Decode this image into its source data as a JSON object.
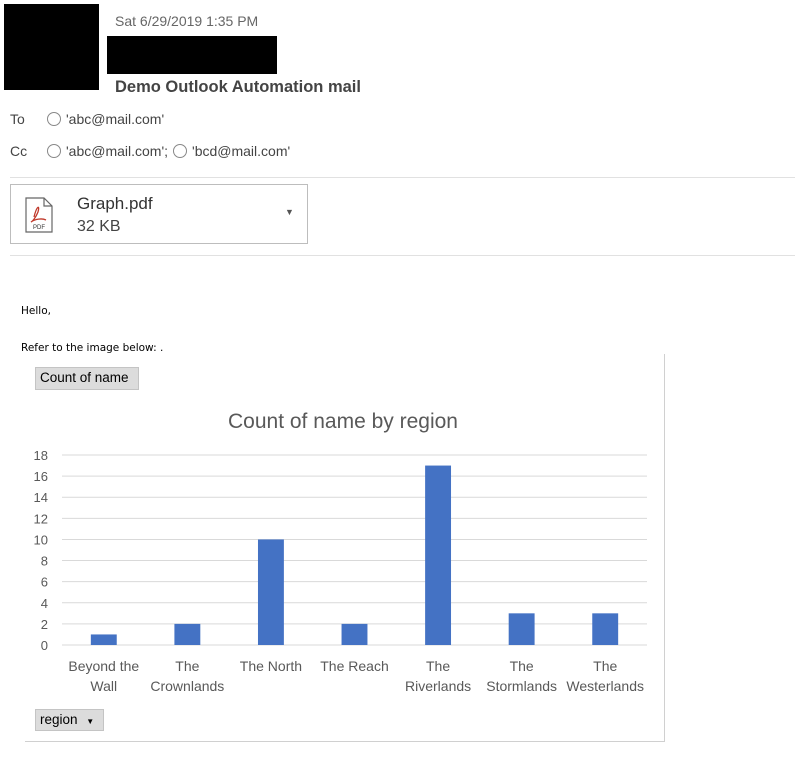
{
  "header": {
    "datetime": "Sat 6/29/2019 1:35 PM",
    "subject": "Demo Outlook Automation mail"
  },
  "recipients": {
    "to_label": "To",
    "to": [
      "'abc@mail.com'"
    ],
    "cc_label": "Cc",
    "cc": [
      "'abc@mail.com';",
      "'bcd@mail.com'"
    ]
  },
  "attachment": {
    "icon": "pdf-file-icon",
    "icon_text": "PDF",
    "name": "Graph.pdf",
    "size": "32 KB",
    "menu_icon": "caret-down-icon"
  },
  "body": {
    "greeting": "Hello,",
    "line": "Refer to the image below: ."
  },
  "pivot": {
    "value_button": "Count of name",
    "axis_button": "region"
  },
  "chart_data": {
    "type": "bar",
    "title": "Count of name by region",
    "categories": [
      "Beyond the Wall",
      "The Crownlands",
      "The North",
      "The Reach",
      "The Riverlands",
      "The Stormlands",
      "The Westerlands"
    ],
    "category_lines": [
      [
        "Beyond the",
        "Wall"
      ],
      [
        "The",
        "Crownlands"
      ],
      [
        "The North"
      ],
      [
        "The Reach"
      ],
      [
        "The",
        "Riverlands"
      ],
      [
        "The",
        "Stormlands"
      ],
      [
        "The",
        "Westerlands"
      ]
    ],
    "values": [
      1,
      2,
      10,
      2,
      17,
      3,
      3
    ],
    "ylim": [
      0,
      18
    ],
    "yticks": [
      "0",
      "2",
      "4",
      "6",
      "8",
      "10",
      "12",
      "14",
      "16",
      "18"
    ],
    "grid": true,
    "bar_color": "#4472c4",
    "xlabel": "",
    "ylabel": ""
  }
}
